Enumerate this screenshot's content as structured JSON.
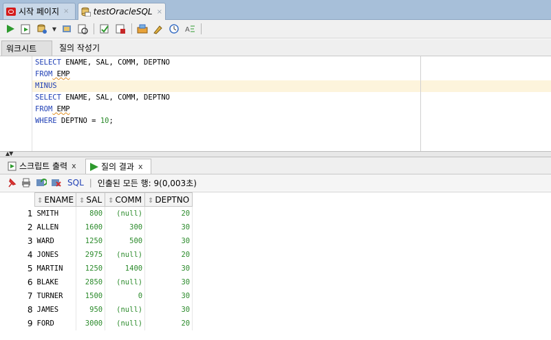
{
  "tabs": [
    {
      "label": "시작 페이지",
      "close": "×"
    },
    {
      "label": "testOracleSQL",
      "close": "×"
    }
  ],
  "subtabs": {
    "worksheet": "워크시트",
    "query_builder": "질의 작성기"
  },
  "editor": {
    "lines": [
      {
        "kw": "SELECT",
        "rest": " ENAME, SAL, COMM, DEPTNO"
      },
      {
        "kw": "FROM",
        "rest": " EMP"
      },
      {
        "kw": "MINUS",
        "rest": ""
      },
      {
        "kw": "SELECT",
        "rest": " ENAME, SAL, COMM, DEPTNO"
      },
      {
        "kw": "FROM",
        "rest": " EMP"
      },
      {
        "kw": "WHERE",
        "rest": " DEPTNO = ",
        "num": "10",
        "end": ";"
      }
    ]
  },
  "result_tabs": {
    "script_output": "스크립트 출력",
    "query_result": "질의 결과",
    "close": "x"
  },
  "result_toolbar": {
    "sql": "SQL",
    "separator": "|",
    "status": "인출된 모든 행: 9(0,003초)"
  },
  "grid": {
    "columns": [
      "ENAME",
      "SAL",
      "COMM",
      "DEPTNO"
    ],
    "rows": [
      {
        "n": "1",
        "ename": "SMITH",
        "sal": "800",
        "comm": "(null)",
        "deptno": "20"
      },
      {
        "n": "2",
        "ename": "ALLEN",
        "sal": "1600",
        "comm": "300",
        "deptno": "30"
      },
      {
        "n": "3",
        "ename": "WARD",
        "sal": "1250",
        "comm": "500",
        "deptno": "30"
      },
      {
        "n": "4",
        "ename": "JONES",
        "sal": "2975",
        "comm": "(null)",
        "deptno": "20"
      },
      {
        "n": "5",
        "ename": "MARTIN",
        "sal": "1250",
        "comm": "1400",
        "deptno": "30"
      },
      {
        "n": "6",
        "ename": "BLAKE",
        "sal": "2850",
        "comm": "(null)",
        "deptno": "30"
      },
      {
        "n": "7",
        "ename": "TURNER",
        "sal": "1500",
        "comm": "0",
        "deptno": "30"
      },
      {
        "n": "8",
        "ename": "JAMES",
        "sal": "950",
        "comm": "(null)",
        "deptno": "30"
      },
      {
        "n": "9",
        "ename": "FORD",
        "sal": "3000",
        "comm": "(null)",
        "deptno": "20"
      }
    ]
  },
  "colors": {
    "keyword": "#1f3fb5",
    "number": "#2a8a2a",
    "current_line": "#fdf4dc",
    "tab_bar": "#a7bfd9"
  },
  "icons": [
    "oracle-icon",
    "sql-worksheet-icon",
    "run-statement-icon",
    "run-script-icon",
    "commit-icon",
    "rollback-icon",
    "autotrace-icon",
    "explain-plan-icon",
    "clear-icon",
    "history-icon",
    "format-icon",
    "pin-icon",
    "print-icon",
    "refresh-icon",
    "delete-icon"
  ]
}
